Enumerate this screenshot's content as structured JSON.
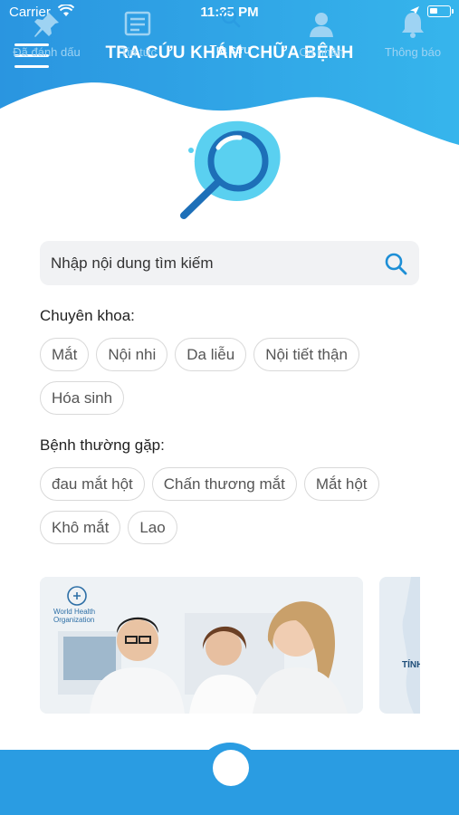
{
  "status_bar": {
    "carrier": "Carrier",
    "time": "11:35 PM"
  },
  "header": {
    "title": "TRA CỨU KHÁM CHỮA BỆNH"
  },
  "search": {
    "placeholder": "Nhập nội dung tìm kiếm"
  },
  "specialties": {
    "label": "Chuyên khoa:",
    "items": [
      "Mắt",
      "Nội nhi",
      "Da liễu",
      "Nội tiết thận",
      "Hóa sinh"
    ]
  },
  "common_diseases": {
    "label": "Bệnh thường gặp:",
    "items": [
      "đau mắt hột",
      "Chấn thương mắt",
      "Mắt hột",
      "Khô mắt",
      "Lao"
    ]
  },
  "banners": {
    "first": {
      "logo_text_1": "World Health",
      "logo_text_2": "Organization"
    },
    "second": {
      "text": "TÍNH"
    }
  },
  "tabs": [
    {
      "label": "Đã đánh dấu",
      "icon": "pin-icon"
    },
    {
      "label": "Tin tức",
      "icon": "newspaper-icon"
    },
    {
      "label": "Tra cứu",
      "icon": "search-icon",
      "active": true
    },
    {
      "label": "Cá nhân",
      "icon": "person-icon"
    },
    {
      "label": "Thông báo",
      "icon": "bell-icon"
    }
  ],
  "colors": {
    "primary": "#2a9ce2",
    "inactive_tab": "#9ed3f3",
    "chip_border": "#d9d9d9"
  }
}
